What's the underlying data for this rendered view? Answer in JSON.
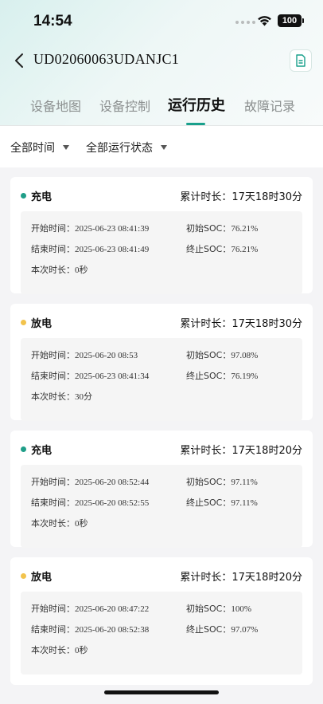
{
  "status": {
    "time": "14:54",
    "battery": "100"
  },
  "header": {
    "title": "UD02060063UDANJC1"
  },
  "tabs": [
    {
      "label": "设备地图"
    },
    {
      "label": "设备控制"
    },
    {
      "label": "运行历史"
    },
    {
      "label": "故障记录"
    }
  ],
  "filters": {
    "time": "全部时间",
    "state": "全部运行状态"
  },
  "labels": {
    "cumulative": "累计时长：",
    "start_time": "开始时间：",
    "end_time": "结束时间：",
    "duration": "本次时长：",
    "start_soc": "初始SOC：",
    "end_soc": "终止SOC："
  },
  "colors": {
    "charge": "#1f9e88",
    "discharge": "#f2c34c",
    "accent": "#19a08c"
  },
  "records": [
    {
      "state": "充电",
      "kind": "charge",
      "cumulative": "17天18时30分",
      "start": "2025-06-23 08:41:39",
      "end": "2025-06-23 08:41:49",
      "duration": "0秒",
      "soc_start": "76.21%",
      "soc_end": "76.21%"
    },
    {
      "state": "放电",
      "kind": "discharge",
      "cumulative": "17天18时30分",
      "start": "2025-06-20 08:53",
      "end": "2025-06-23 08:41:34",
      "duration": "30分",
      "soc_start": "97.08%",
      "soc_end": "76.19%"
    },
    {
      "state": "充电",
      "kind": "charge",
      "cumulative": "17天18时20分",
      "start": "2025-06-20 08:52:44",
      "end": "2025-06-20 08:52:55",
      "duration": "0秒",
      "soc_start": "97.11%",
      "soc_end": "97.11%"
    },
    {
      "state": "放电",
      "kind": "discharge",
      "cumulative": "17天18时20分",
      "start": "2025-06-20 08:47:22",
      "end": "2025-06-20 08:52:38",
      "duration": "0秒",
      "soc_start": "100%",
      "soc_end": "97.07%"
    }
  ]
}
